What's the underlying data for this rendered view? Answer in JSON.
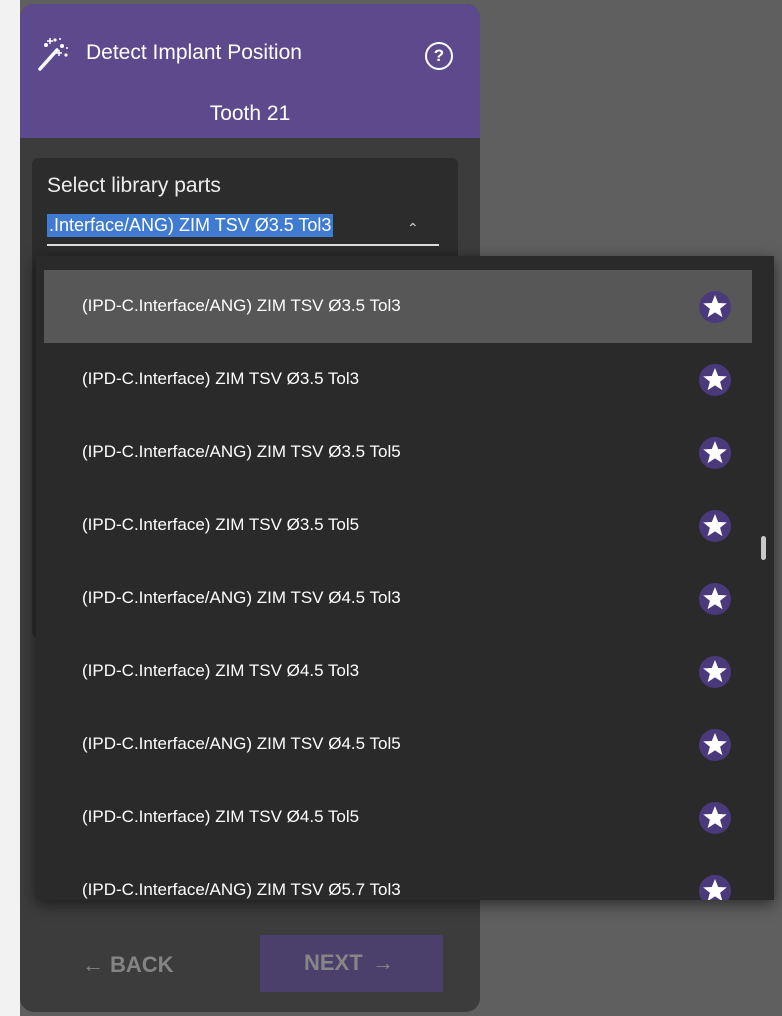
{
  "header": {
    "title": "Detect Implant Position",
    "subtitle": "Tooth 21",
    "help_icon": "question-circle-icon",
    "wand_icon": "magic-wand-icon"
  },
  "select": {
    "label": "Select library parts",
    "value": ".Interface/ANG) ZIM TSV Ø3.5 Tol3",
    "chevron": "^"
  },
  "dropdown": {
    "items": [
      {
        "label": "(IPD-C.Interface/ANG) ZIM TSV Ø3.5 Tol3",
        "selected": true,
        "icon": "star-icon"
      },
      {
        "label": "(IPD-C.Interface) ZIM TSV Ø3.5 Tol3",
        "icon": "star-icon"
      },
      {
        "label": "(IPD-C.Interface/ANG) ZIM TSV Ø3.5 Tol5",
        "icon": "star-icon"
      },
      {
        "label": "(IPD-C.Interface) ZIM TSV Ø3.5 Tol5",
        "icon": "star-icon"
      },
      {
        "label": "(IPD-C.Interface/ANG) ZIM TSV Ø4.5 Tol3",
        "icon": "star-icon"
      },
      {
        "label": "(IPD-C.Interface) ZIM TSV Ø4.5 Tol3",
        "icon": "star-icon"
      },
      {
        "label": "(IPD-C.Interface/ANG) ZIM TSV Ø4.5 Tol5",
        "icon": "star-icon"
      },
      {
        "label": "(IPD-C.Interface) ZIM TSV Ø4.5 Tol5",
        "icon": "star-icon"
      },
      {
        "label": "(IPD-C.Interface/ANG) ZIM TSV Ø5.7 Tol3",
        "icon": "star-icon"
      }
    ]
  },
  "footer": {
    "back_arrow": "←",
    "back_label": "BACK",
    "next_label": "NEXT",
    "next_arrow": "→"
  },
  "colors": {
    "header": "#5d4a8c",
    "panel": "#3c3c3c",
    "dropdown": "#2a2a2a",
    "selected_row": "#575757",
    "star_circle": "#4a3a7c",
    "selection_highlight": "#3f7bd0",
    "next_button": "#4b3f6b"
  }
}
